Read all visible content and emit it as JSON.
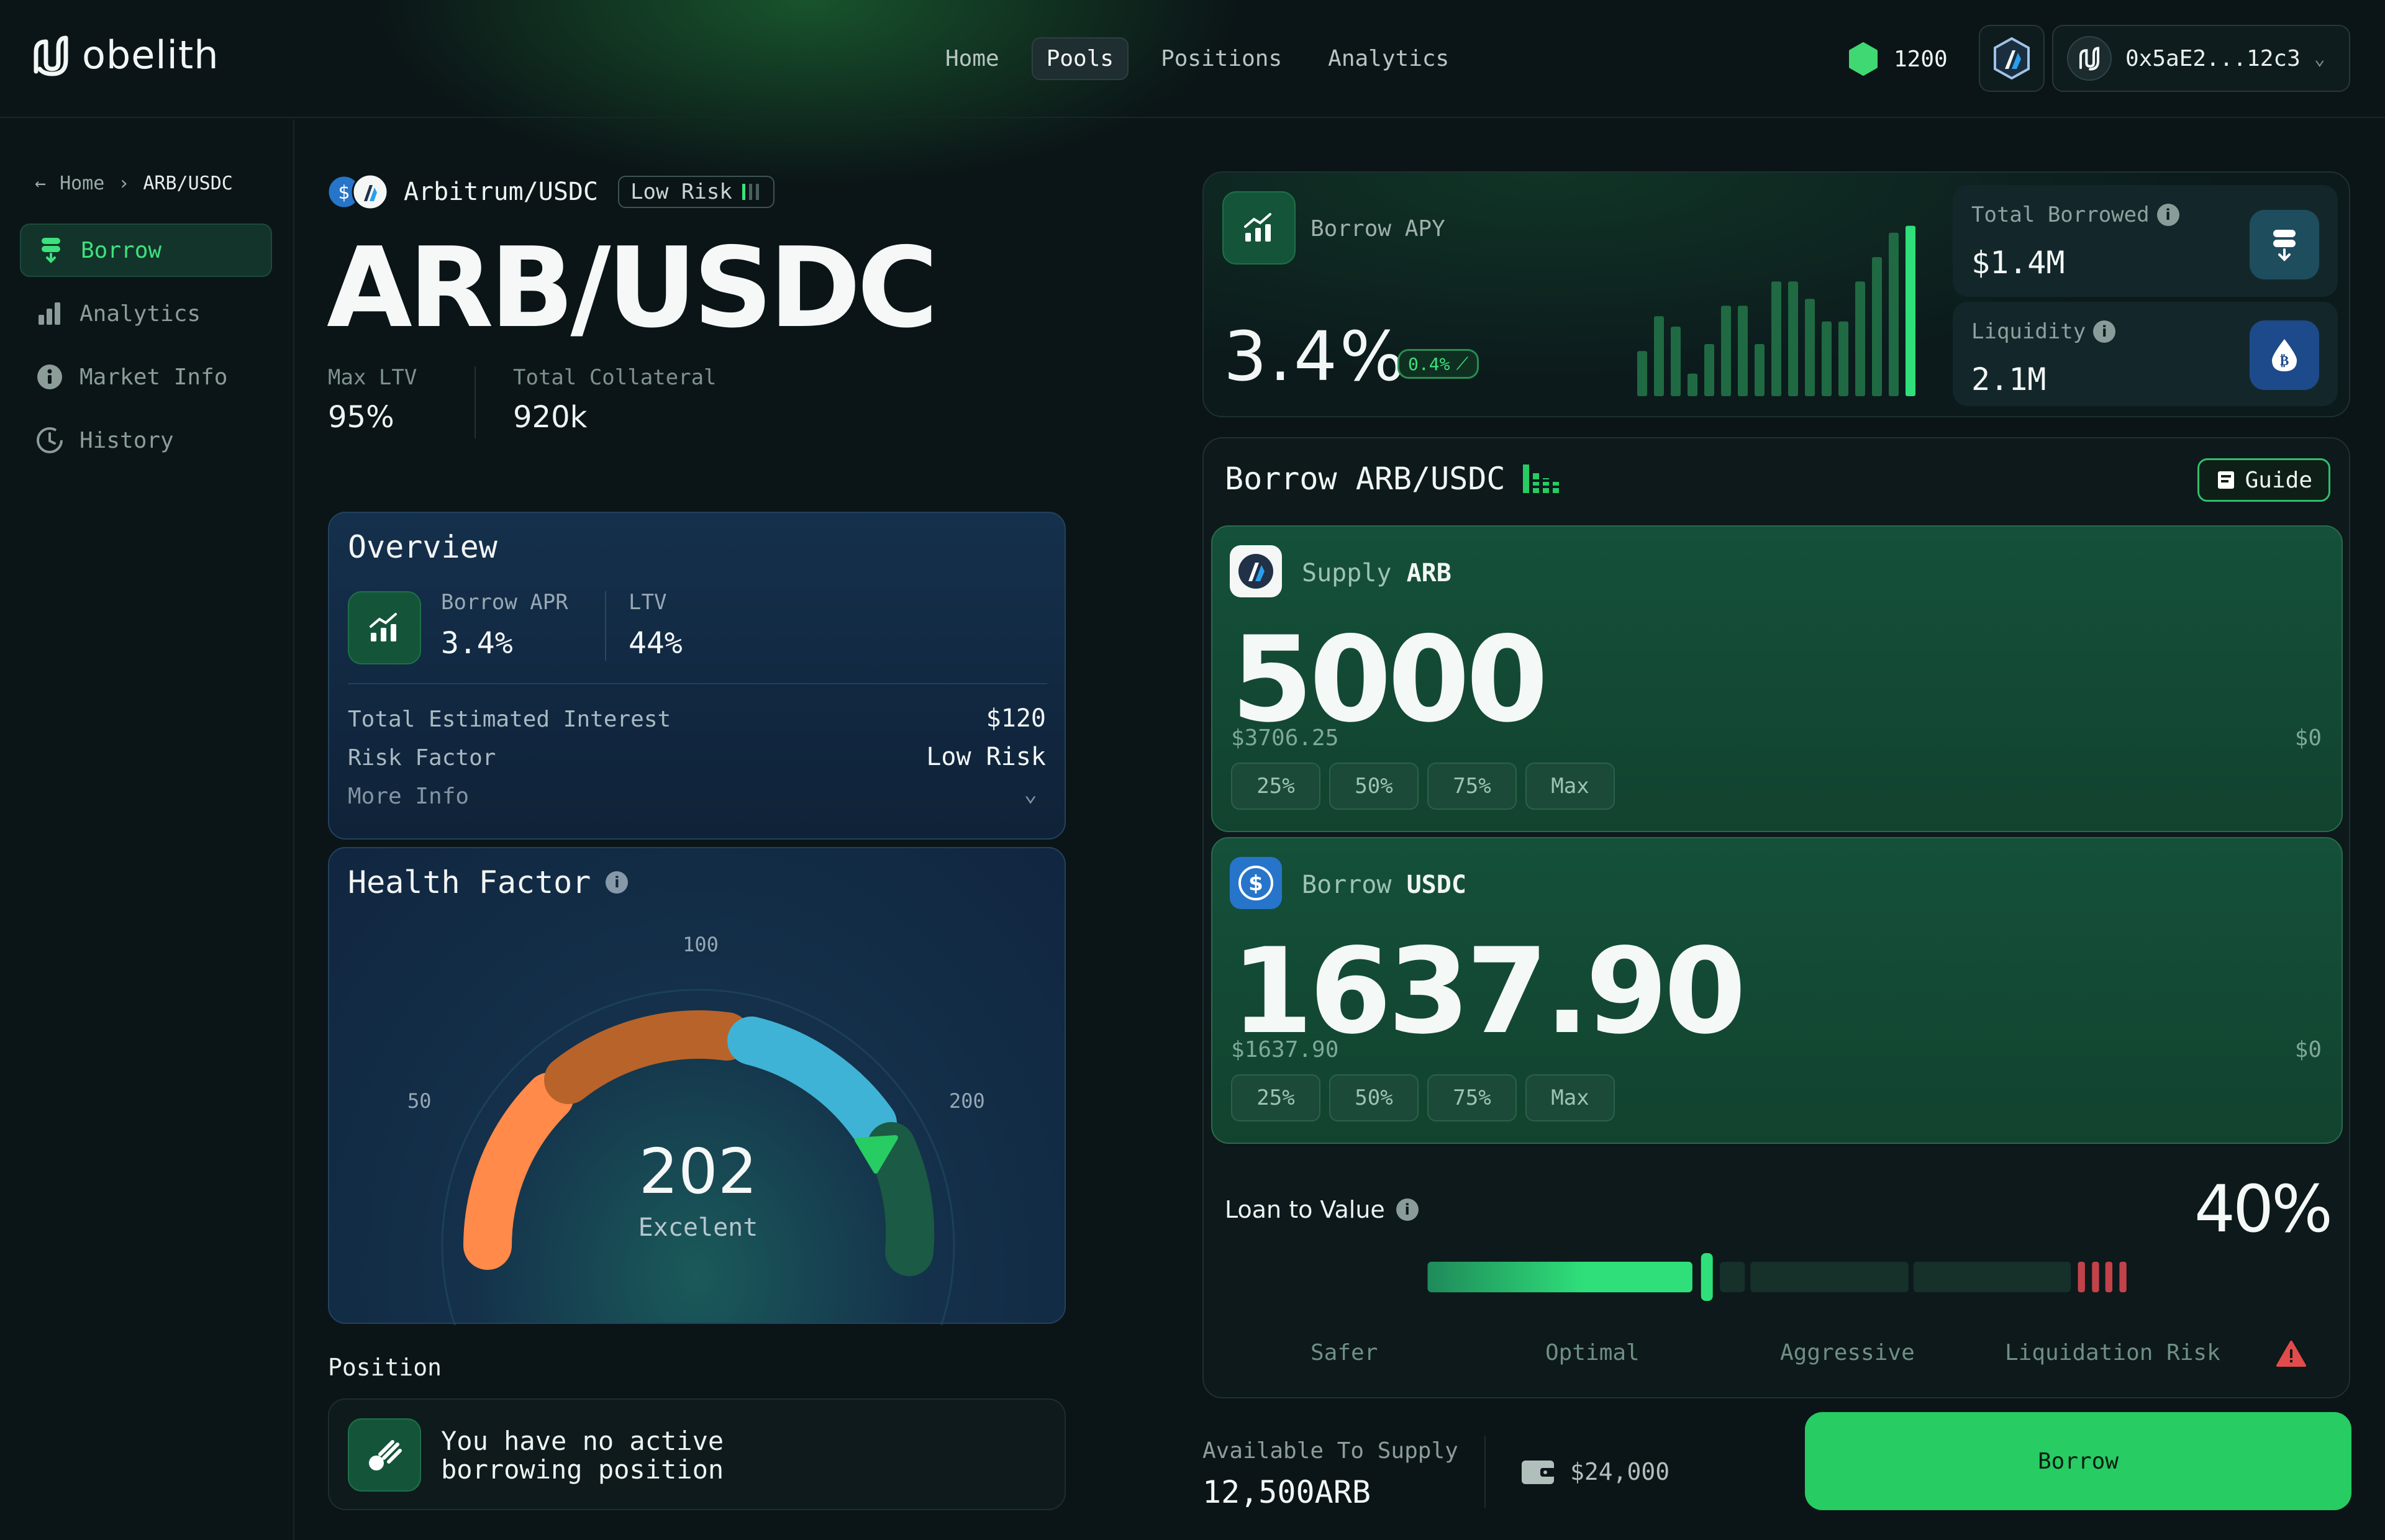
{
  "app": {
    "name": "obelith"
  },
  "nav": {
    "items": [
      "Home",
      "Pools",
      "Positions",
      "Analytics"
    ],
    "active": "Pools"
  },
  "header": {
    "points": "1200",
    "wallet_address": "0x5aE2...12c3",
    "points_color": "#3fd872"
  },
  "breadcrumb": {
    "home": "Home",
    "current": "ARB/USDC"
  },
  "sidebar": {
    "items": [
      {
        "label": "Borrow",
        "icon": "stack-icon",
        "active": true
      },
      {
        "label": "Analytics",
        "icon": "bar-chart-icon"
      },
      {
        "label": "Market Info",
        "icon": "info-icon"
      },
      {
        "label": "History",
        "icon": "clock-icon"
      }
    ]
  },
  "pair": {
    "name": "Arbitrum/USDC",
    "risk_badge": "Low Risk",
    "title": "ARB/USDC",
    "max_ltv_label": "Max LTV",
    "max_ltv": "95%",
    "total_collateral_label": "Total Collateral",
    "total_collateral": "920k"
  },
  "overview": {
    "title": "Overview",
    "borrow_apr_label": "Borrow APR",
    "borrow_apr": "3.4%",
    "ltv_label": "LTV",
    "ltv": "44%",
    "interest_label": "Total Estimated Interest",
    "interest": "$120",
    "risk_label": "Risk Factor",
    "risk": "Low Risk",
    "more_info": "More Info"
  },
  "health": {
    "title": "Health Factor",
    "value": "202",
    "status": "Excelent",
    "tick_50": "50",
    "tick_100": "100",
    "tick_200": "200",
    "value_num": 202
  },
  "position": {
    "label": "Position",
    "empty_line1": "You have no active",
    "empty_line2": "borrowing position"
  },
  "apy": {
    "label": "Borrow APY",
    "value": "3.4%",
    "change": "0.4%",
    "bars": [
      0.26,
      0.46,
      0.4,
      0.13,
      0.3,
      0.52,
      0.52,
      0.3,
      0.66,
      0.66,
      0.56,
      0.43,
      0.43,
      0.66,
      0.8,
      0.94,
      0.98
    ]
  },
  "stats": {
    "total_borrowed_label": "Total Borrowed",
    "total_borrowed": "$1.4M",
    "liquidity_label": "Liquidity",
    "liquidity": "2.1M"
  },
  "borrow_form": {
    "title": "Borrow ARB/USDC",
    "guide": "Guide",
    "supply": {
      "action": "Supply",
      "token": "ARB",
      "amount": "5000",
      "usd": "$3706.25",
      "usd_right": "$0"
    },
    "borrow": {
      "action": "Borrow",
      "token": "USDC",
      "amount": "1637.90",
      "usd": "$1637.90",
      "usd_right": "$0"
    },
    "pct_buttons": [
      "25%",
      "50%",
      "75%",
      "Max"
    ],
    "ltv_label": "Loan to Value",
    "ltv_value": "40%",
    "ltv_fraction": 0.4,
    "segments": [
      "Safer",
      "Optimal",
      "Aggressive",
      "Liquidation Risk"
    ]
  },
  "footer": {
    "available_label": "Available To Supply",
    "available_value": "12,500ARB",
    "wallet_balance": "$24,000",
    "borrow_button": "Borrow"
  },
  "colors": {
    "accent": "#27cc63",
    "danger": "#e24b4b",
    "gauge_orange": "#ff8a4a",
    "gauge_brown": "#b8632a",
    "gauge_blue": "#3fb3d6",
    "gauge_dark": "#1b5a44"
  }
}
